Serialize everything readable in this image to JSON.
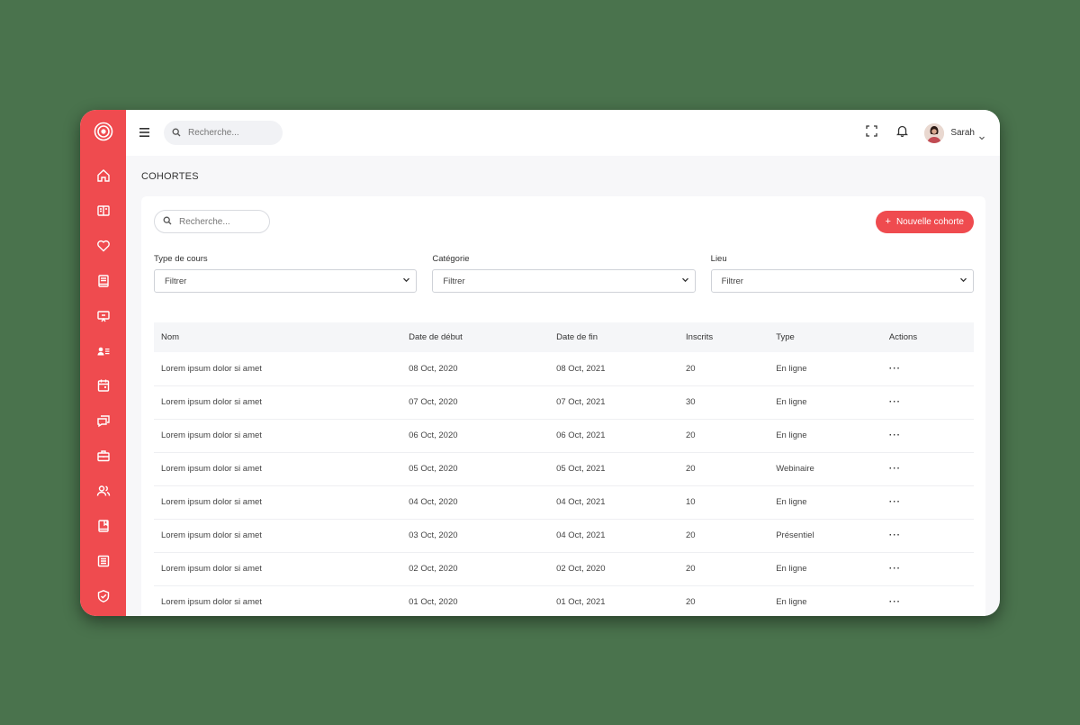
{
  "topbar": {
    "search_placeholder": "Recherche...",
    "user_name": "Sarah"
  },
  "page": {
    "title": "COHORTES"
  },
  "toolbar": {
    "search_placeholder": "Recherche...",
    "new_button_label": "Nouvelle cohorte"
  },
  "filters": [
    {
      "label": "Type de cours",
      "value": "Filtrer"
    },
    {
      "label": "Catégorie",
      "value": "Filtrer"
    },
    {
      "label": "Lieu",
      "value": "Filtrer"
    }
  ],
  "table": {
    "headers": [
      "Nom",
      "Date de début",
      "Date de fin",
      "Inscrits",
      "Type",
      "Actions"
    ],
    "rows": [
      {
        "nom": "Lorem ipsum dolor si amet",
        "debut": "08 Oct, 2020",
        "fin": "08 Oct, 2021",
        "inscrits": "20",
        "type": "En ligne",
        "actions": "···"
      },
      {
        "nom": "Lorem ipsum dolor si amet",
        "debut": "07 Oct, 2020",
        "fin": "07 Oct, 2021",
        "inscrits": "30",
        "type": "En ligne",
        "actions": "···"
      },
      {
        "nom": "Lorem ipsum dolor si amet",
        "debut": "06 Oct, 2020",
        "fin": "06 Oct, 2021",
        "inscrits": "20",
        "type": "En ligne",
        "actions": "···"
      },
      {
        "nom": "Lorem ipsum dolor si amet",
        "debut": "05 Oct, 2020",
        "fin": "05 Oct, 2021",
        "inscrits": "20",
        "type": "Webinaire",
        "actions": "···"
      },
      {
        "nom": "Lorem ipsum dolor si amet",
        "debut": "04 Oct, 2020",
        "fin": "04 Oct, 2021",
        "inscrits": "10",
        "type": "En ligne",
        "actions": "···"
      },
      {
        "nom": "Lorem ipsum dolor si amet",
        "debut": "03 Oct, 2020",
        "fin": "04 Oct, 2021",
        "inscrits": "20",
        "type": "Présentiel",
        "actions": "···"
      },
      {
        "nom": "Lorem ipsum dolor si amet",
        "debut": "02 Oct, 2020",
        "fin": "02 Oct, 2020",
        "inscrits": "20",
        "type": "En ligne",
        "actions": "···"
      },
      {
        "nom": "Lorem ipsum dolor si amet",
        "debut": "01 Oct, 2020",
        "fin": "01 Oct, 2021",
        "inscrits": "20",
        "type": "En ligne",
        "actions": "···"
      }
    ]
  },
  "sidebar": {
    "items": [
      {
        "icon": "home-icon"
      },
      {
        "icon": "book-open-icon"
      },
      {
        "icon": "heart-icon"
      },
      {
        "icon": "book-icon"
      },
      {
        "icon": "presentation-icon"
      },
      {
        "icon": "contact-list-icon"
      },
      {
        "icon": "calendar-icon"
      },
      {
        "icon": "chat-icon"
      },
      {
        "icon": "briefcase-icon"
      },
      {
        "icon": "users-icon"
      },
      {
        "icon": "bookmark-book-icon"
      },
      {
        "icon": "list-icon"
      },
      {
        "icon": "shield-check-icon"
      }
    ]
  },
  "colors": {
    "accent": "#ef4b4f",
    "background": "#4a734d",
    "page_bg": "#f7f7f9"
  }
}
